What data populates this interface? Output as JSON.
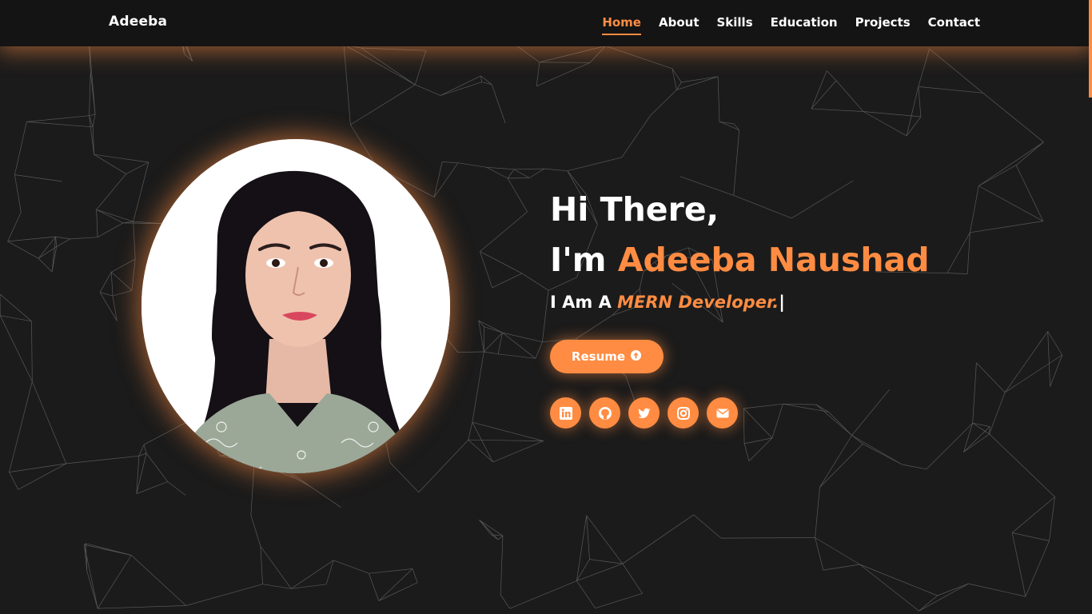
{
  "brand": "Adeeba",
  "nav": [
    {
      "label": "Home",
      "active": true
    },
    {
      "label": "About",
      "active": false
    },
    {
      "label": "Skills",
      "active": false
    },
    {
      "label": "Education",
      "active": false
    },
    {
      "label": "Projects",
      "active": false
    },
    {
      "label": "Contact",
      "active": false
    }
  ],
  "hero": {
    "greeting": "Hi There,",
    "intro_prefix": "I'm ",
    "name": "Adeeba Naushad",
    "role_prefix": "I Am A ",
    "role": "MERN Developer.",
    "cursor": "|",
    "resume_label": "Resume",
    "resume_icon": "arrow-up-circle-icon"
  },
  "social": [
    {
      "name": "linkedin-icon"
    },
    {
      "name": "github-icon"
    },
    {
      "name": "twitter-icon"
    },
    {
      "name": "instagram-icon"
    },
    {
      "name": "envelope-icon"
    }
  ],
  "colors": {
    "accent": "#ff8c42",
    "background": "#1b1b1b",
    "navbar": "#141414",
    "text": "#ffffff",
    "network_lines": "#8a8a8a"
  }
}
